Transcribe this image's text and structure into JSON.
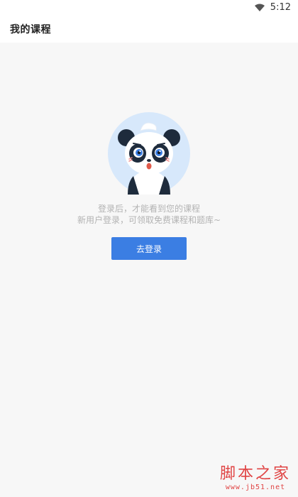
{
  "status_bar": {
    "time": "5:12",
    "wifi_icon": "wifi-icon"
  },
  "header": {
    "title": "我的课程"
  },
  "empty_state": {
    "illustration": "panda-avatar",
    "line1": "登录后，才能看到您的课程",
    "line2": "新用户登录，可领取免费课程和题库~",
    "button_label": "去登录"
  },
  "watermark": {
    "title": "脚本之家",
    "url": "www.jb51.net"
  },
  "colors": {
    "background": "#f7f7f7",
    "accent": "#3b7ee3",
    "hint_text": "#b3b3b3",
    "avatar_bg": "#d7e8fb",
    "watermark": "#e04444"
  }
}
